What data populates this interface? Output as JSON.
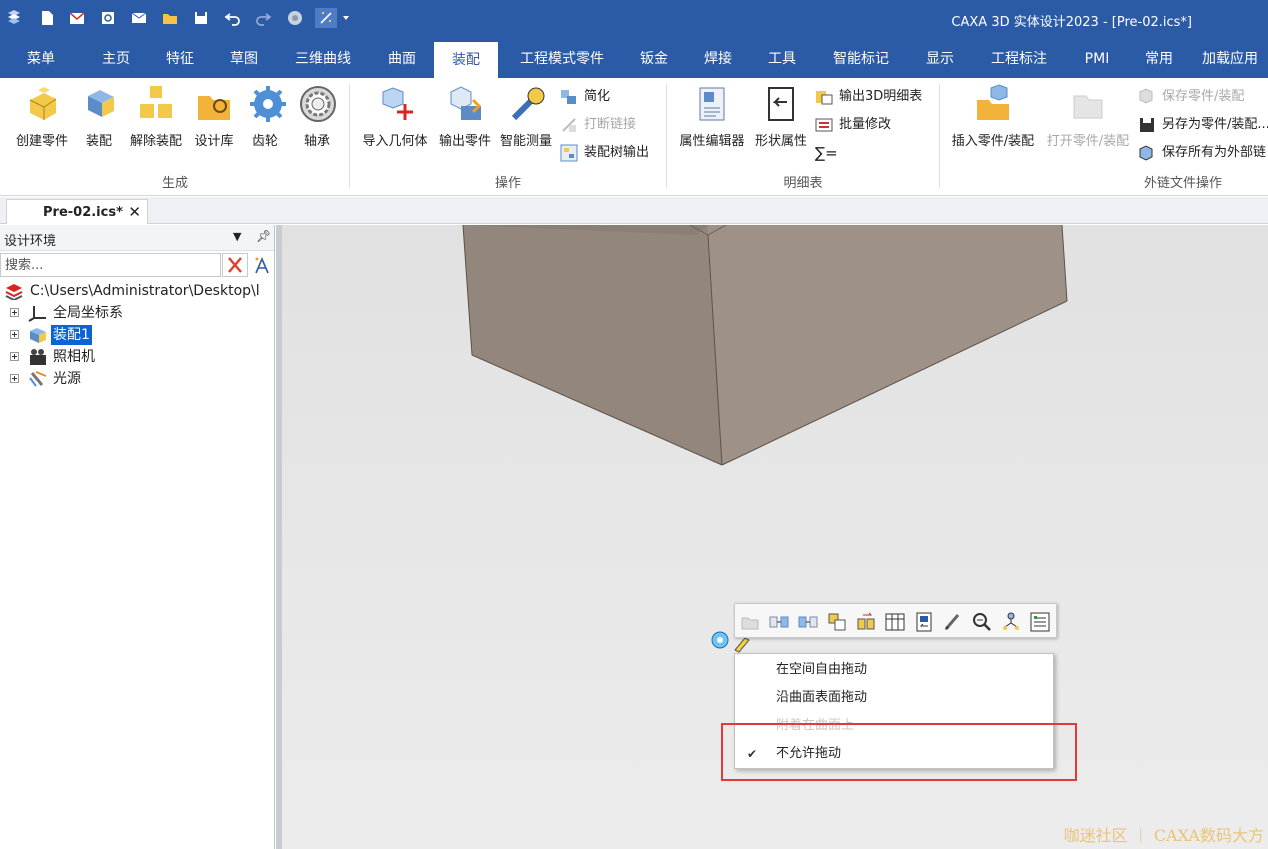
{
  "window": {
    "title": "CAXA 3D 实体设计2023 - [Pre-02.ics*]"
  },
  "quick_access": [
    "app-menu-icon",
    "new-icon",
    "open-mail-icon",
    "print-preview-icon",
    "send-icon",
    "folder-icon",
    "save-icon",
    "undo-icon",
    "redo-icon",
    "shirt-icon",
    "wizard-icon",
    "dropdown-icon"
  ],
  "tabs": [
    "菜单",
    "主页",
    "特征",
    "草图",
    "三维曲线",
    "曲面",
    "装配",
    "工程模式零件",
    "钣金",
    "焊接",
    "工具",
    "智能标记",
    "显示",
    "工程标注",
    "PMI",
    "常用",
    "加载应用"
  ],
  "active_tab": "装配",
  "ribbon": {
    "generate": {
      "label": "生成",
      "buttons": [
        "创建零件",
        "装配",
        "解除装配",
        "设计库",
        "齿轮",
        "轴承"
      ]
    },
    "operate": {
      "label": "操作",
      "buttons": [
        "导入几何体",
        "输出零件",
        "智能测量"
      ],
      "small": [
        "简化",
        "打断链接",
        "装配树输出"
      ]
    },
    "bom": {
      "label": "明细表",
      "buttons": [
        "属性编辑器",
        "形状属性"
      ],
      "small": [
        "输出3D明细表",
        "批量修改",
        "∑="
      ]
    },
    "extlink": {
      "label": "外链文件操作",
      "buttons": [
        "插入零件/装配",
        "打开零件/装配"
      ],
      "small": [
        "保存零件/装配",
        "另存为零件/装配...",
        "保存所有为外部链"
      ]
    }
  },
  "document_tab": {
    "label": "Pre-02.ics*",
    "close": "✕"
  },
  "panel": {
    "title": "设计环境",
    "search_placeholder": "搜索...",
    "tree": {
      "root": "C:\\Users\\Administrator\\Desktop\\l",
      "items": [
        "全局坐标系",
        "装配1",
        "照相机",
        "光源"
      ]
    }
  },
  "context_menu": {
    "items": [
      "在空间自由拖动",
      "沿曲面表面拖动",
      "附着在曲面上",
      "不允许拖动"
    ],
    "checked": "不允许拖动"
  },
  "watermark": "咖迷社区 ｜ CAXA数码大方",
  "colors": {
    "titlebar": "#2b5aa7",
    "selection": "#0a64d6",
    "highlight": "#e03a3a",
    "model": "#978a80"
  }
}
